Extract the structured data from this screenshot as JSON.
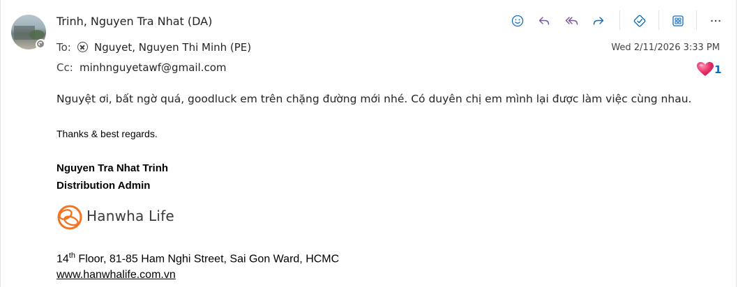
{
  "header": {
    "from": "Trinh, Nguyen Tra Nhat (DA)",
    "to_label": "To:",
    "to_name": "Nguyet, Nguyen Thi Minh (PE)",
    "cc_label": "Cc:",
    "cc_value": "minhnguyetawf@gmail.com",
    "timestamp": "Wed 2/11/2026 3:33 PM"
  },
  "toolbar": {
    "icons": [
      "emoji-icon",
      "reply-icon",
      "reply-all-icon",
      "forward-icon",
      "pin-icon",
      "apps-icon",
      "more-icon"
    ]
  },
  "reaction": {
    "emoji": "heart",
    "count": "1"
  },
  "message": {
    "body": "Nguyệt ơi, bất ngờ quá, goodluck em trên chặng đường mới nhé. Có duyên chị em mình lại được làm việc cùng nhau."
  },
  "signature": {
    "thanks": "Thanks & best regards.",
    "name": "Nguyen Tra Nhat Trinh",
    "title": "Distribution Admin",
    "logo_text": "Hanwha Life",
    "address_number": "14",
    "address_sup": "th",
    "address_rest": " Floor, 81-85 Ham Nghi Street, Sai Gon Ward, HCMC",
    "website": "www.hanwhalife.com.vn"
  },
  "colors": {
    "accent": "#0f6cbd",
    "reply_purple": "#7a4ea0",
    "heart": "#e8336a",
    "logo_orange": "#f37321"
  }
}
